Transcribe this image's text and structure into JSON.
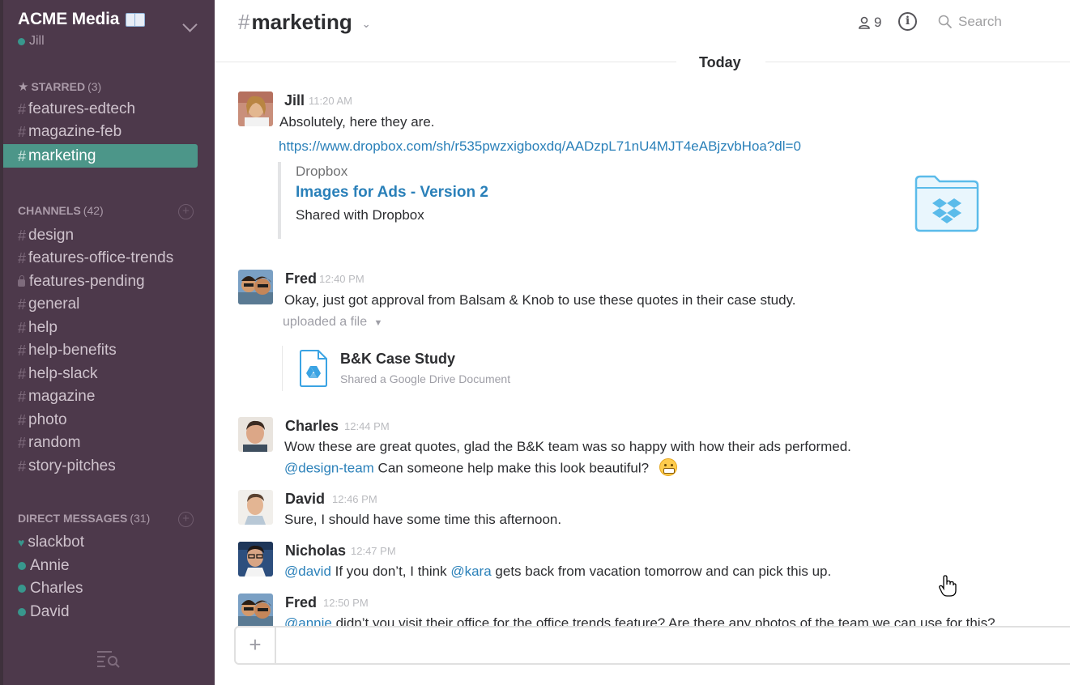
{
  "team": {
    "name": "ACME Media",
    "user": "Jill"
  },
  "sidebar": {
    "starred": {
      "label": "STARRED",
      "count": "(3)",
      "items": [
        "features-edtech",
        "magazine-feb",
        "marketing"
      ]
    },
    "channels": {
      "label": "CHANNELS",
      "count": "(42)",
      "items": [
        "design",
        "features-office-trends",
        "features-pending",
        "general",
        "help",
        "help-benefits",
        "help-slack",
        "magazine",
        "photo",
        "random",
        "story-pitches"
      ]
    },
    "direct_messages": {
      "label": "DIRECT MESSAGES",
      "count": "(31)",
      "items": [
        "slackbot",
        "Annie",
        "Charles",
        "David"
      ]
    }
  },
  "header": {
    "channel": "marketing",
    "member_count": "9",
    "search_placeholder": "Search"
  },
  "day_divider": "Today",
  "messages": [
    {
      "sender": "Jill",
      "time": "11:20 AM",
      "text": "Absolutely, here they are.",
      "link": "https://www.dropbox.com/sh/r535pwzxigboxdq/AADzpL71nU4MJT4eABjzvbHoa?dl=0",
      "attachment": {
        "service": "Dropbox",
        "title": "Images for Ads - Version 2",
        "description": "Shared with Dropbox"
      }
    },
    {
      "sender": "Fred",
      "time": "12:40 PM",
      "text": "Okay, just got approval from Balsam & Knob to use these quotes in their case study.",
      "uploaded": "uploaded a file",
      "file": {
        "title": "B&K Case Study",
        "subtitle": "Shared a Google Drive Document"
      }
    },
    {
      "sender": "Charles",
      "time": "12:44 PM",
      "text": "Wow these are great quotes, glad the B&K team was so happy with how their ads performed.",
      "mention": "@design-team",
      "text2": "Can someone help make this look beautiful?"
    },
    {
      "sender": "David",
      "time": "12:46 PM",
      "text": "Sure, I should have some time this afternoon."
    },
    {
      "sender": "Nicholas",
      "time": "12:47 PM",
      "mention1": "@david",
      "text1": "If you don’t, I think",
      "mention2": "@kara",
      "text2": "gets back from vacation tomorrow and can pick this up."
    },
    {
      "sender": "Fred",
      "time": "12:50 PM",
      "mention": "@annie",
      "text": "didn’t you visit their office for the office trends feature? Are there any photos of the team we can use for this?"
    }
  ],
  "composer": {
    "value": ""
  },
  "icons": {
    "team_menu": "chevron-down-icon",
    "starred": "star-icon",
    "members": "person-icon",
    "info": "info-icon",
    "search": "search-icon",
    "composer_add": "plus-icon",
    "sidebar_footer": "search-list-icon",
    "dropbox": "dropbox-folder-icon",
    "gdrive": "google-drive-file-icon"
  },
  "colors": {
    "sidebar_bg": "#4d394b",
    "active_channel": "#4c9689",
    "presence": "#38978d",
    "link": "#2a80b9"
  }
}
